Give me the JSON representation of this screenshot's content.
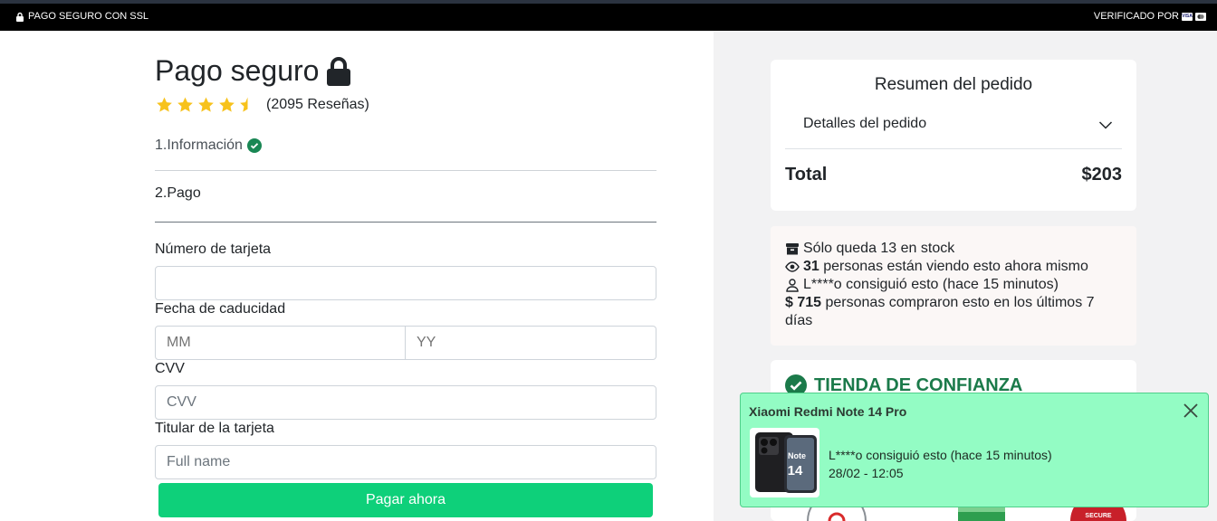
{
  "topbar": {
    "left_text": "PAGO SEGURO CON SSL",
    "right_text": "VERIFICADO POR",
    "card_visa": "VISA"
  },
  "checkout": {
    "title": "Pago seguro",
    "rating_value": 4.5,
    "rating_max": 5,
    "reviews": "(2095 Reseñas)",
    "step1": "1.Información",
    "step2": "2.Pago",
    "card_number_label": "Número de tarjeta",
    "card_number_value": "",
    "expiry_label": "Fecha de caducidad",
    "expiry_month_placeholder": "MM",
    "expiry_year_placeholder": "YY",
    "cvv_label": "CVV",
    "cvv_placeholder": "CVV",
    "holder_label": "Titular de la tarjeta",
    "holder_placeholder": "Full name",
    "pay_button": "Pagar ahora",
    "pay_color": "#0ed07a"
  },
  "summary": {
    "title": "Resumen del pedido",
    "details_label": "Detalles del pedido",
    "total_label": "Total",
    "total_value": "$203"
  },
  "stock": {
    "stock_text": "Sólo queda 13 en stock",
    "viewers_count": "31",
    "viewers_text": "personas están viendo esto ahora mismo",
    "recent_buyer": "L****o consiguió esto (hace 15 minutos)",
    "buyers_count": "$ 715",
    "buyers_text": "personas compraron esto en los últimos 7 días"
  },
  "trust": {
    "title": "TIENDA DE CONFIANZA",
    "accent": "#1b7a4a",
    "secure_badge_text": "SECURE"
  },
  "toast": {
    "product": "Xiaomi Redmi Note 14 Pro",
    "message": "L****o consiguió esto (hace 15 minutos)",
    "time": "28/02 - 12:05",
    "thumb_text_line1": "Note",
    "thumb_text_line2": "14",
    "background": "#93fcc4"
  }
}
